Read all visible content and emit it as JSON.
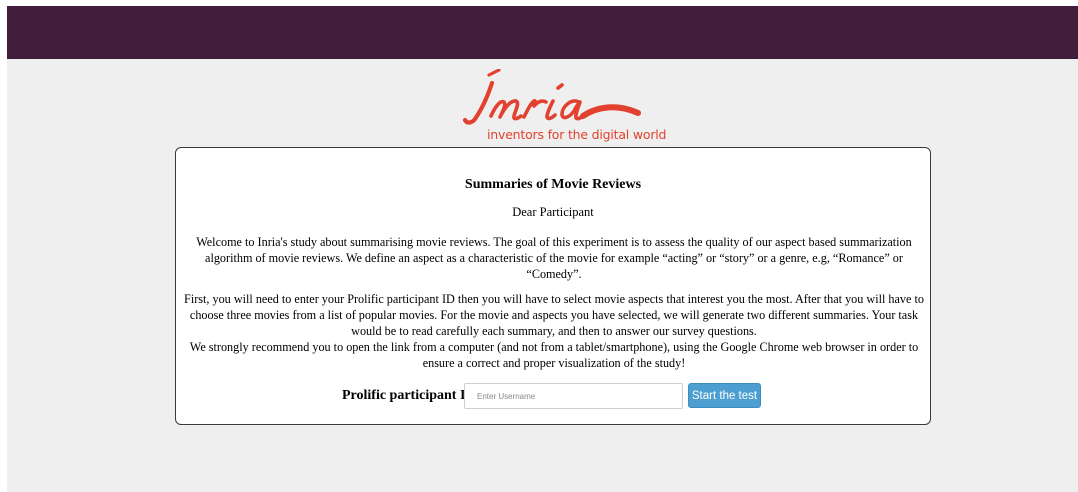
{
  "header": {
    "bar_color": "#421c3b"
  },
  "logo": {
    "wordmark": "Inria",
    "tagline": "inventors for the digital world",
    "color": "#e2412f"
  },
  "card": {
    "title": "Summaries of Movie Reviews",
    "greeting": "Dear Participant",
    "intro": "Welcome to Inria's study about summarising movie reviews. The goal of this experiment is to assess the quality of our aspect based summarization algorithm of movie reviews. We define an aspect as a characteristic of the movie for example “acting” or “story” or a genre, e.g, “Romance” or “Comedy”.",
    "instructions": "First, you will need to enter your Prolific participant ID then you will have to select movie aspects that interest you the most. After that you will have to choose three movies from a list of popular movies. For the movie and aspects you have selected, we will generate two different summaries. Your task would be to read carefully each summary, and then to answer our survey questions.",
    "recommendation": "We strongly recommend you to open the link from a computer (and not from a tablet/smartphone), using the Google Chrome web browser in order to ensure a correct and proper visualization of the study!"
  },
  "form": {
    "id_label": "Prolific participant ID",
    "id_placeholder": "Enter Username",
    "id_value": "",
    "start_label": "Start the test",
    "start_color": "#4d9fd1"
  }
}
